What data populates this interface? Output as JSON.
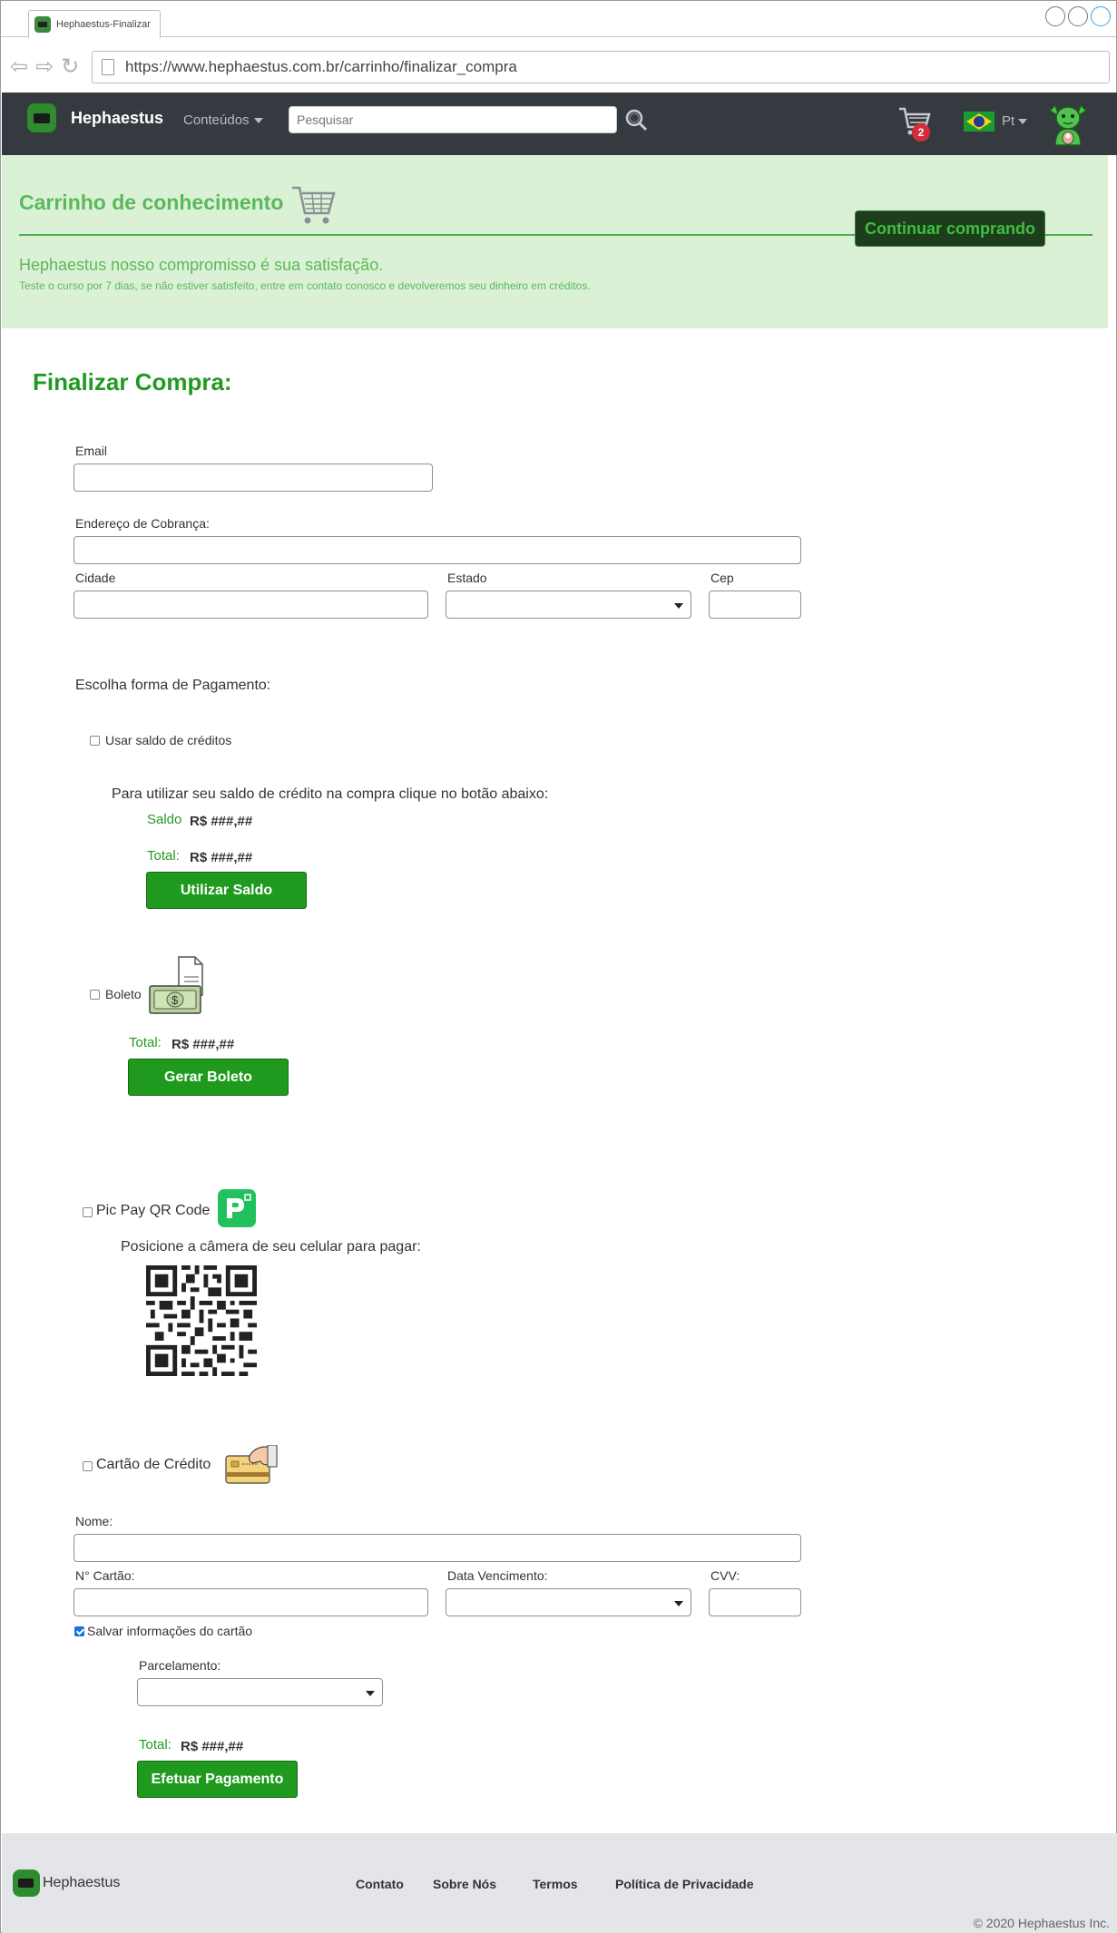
{
  "browser": {
    "tab_title": "Hephaestus-Finalizar",
    "url": "https://www.hephaestus.com.br/carrinho/finalizar_compra"
  },
  "header": {
    "brand": "Hephaestus",
    "menu_label": "Conteúdos",
    "search_placeholder": "Pesquisar",
    "cart_count": "2",
    "language": "Pt"
  },
  "banner": {
    "title": "Carrinho de conhecimento",
    "continue_label": "Continuar comprando",
    "subtitle": "Hephaestus nosso compromisso é sua satisfação.",
    "note": "Teste o curso por 7 dias, se não estiver satisfeito, entre em contato conosco e devolveremos seu dinheiro em créditos."
  },
  "form": {
    "title": "Finalizar Compra:",
    "email_label": "Email",
    "address_label": "Endereço de Cobrança:",
    "city_label": "Cidade",
    "state_label": "Estado",
    "zip_label": "Cep",
    "payment_heading": "Escolha forma de Pagamento:"
  },
  "credits": {
    "checkbox_label": "Usar saldo de créditos",
    "instruction": "Para utilizar seu saldo de crédito na compra clique no botão abaixo:",
    "balance_label": "Saldo",
    "balance_value": "R$ ###,##",
    "total_label": "Total:",
    "total_value": "R$ ###,##",
    "button_label": "Utilizar Saldo"
  },
  "boleto": {
    "checkbox_label": "Boleto",
    "total_label": "Total:",
    "total_value": "R$ ###,##",
    "button_label": "Gerar Boleto"
  },
  "picpay": {
    "checkbox_label": "Pic Pay QR Code",
    "instruction": "Posicione a câmera de seu celular para pagar:"
  },
  "card": {
    "checkbox_label": "Cartão de Crédito",
    "name_label": "Nome:",
    "number_label": "N° Cartão:",
    "expiry_label": "Data Vencimento:",
    "cvv_label": "CVV:",
    "save_label": "Salvar informações do cartão",
    "installments_label": "Parcelamento:",
    "total_label": "Total:",
    "total_value": "R$ ###,##",
    "button_label": "Efetuar Pagamento"
  },
  "footer": {
    "brand": "Hephaestus",
    "links": [
      "Contato",
      "Sobre Nós",
      "Termos",
      "Política de Privacidade"
    ],
    "copyright": "© 2020 Hephaestus Inc."
  },
  "colors": {
    "brand_green": "#229922",
    "header_bg": "#353a40",
    "banner_bg": "#dbf1d6"
  }
}
